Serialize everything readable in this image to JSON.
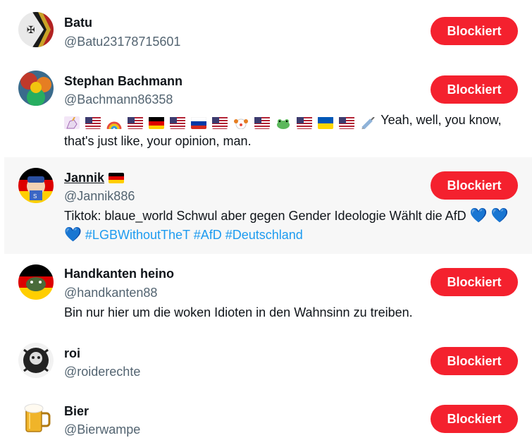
{
  "users": [
    {
      "name": "Batu",
      "handle": "@Batu23178715601",
      "button": "Blockiert"
    },
    {
      "name": "Stephan Bachmann",
      "handle": "@Bachmann86358",
      "button": "Blockiert",
      "bio": "Yeah, well, you know, that's just like, your opinion, man.",
      "bio_emojis": [
        "unicorn-emoji",
        "us-flag",
        "rainbow-emoji",
        "us-flag",
        "germany-flag",
        "us-flag",
        "russia-flag",
        "us-flag",
        "clown-emoji",
        "us-flag",
        "frog-emoji",
        "us-flag",
        "ukraine-flag",
        "us-flag",
        "syringe-emoji"
      ]
    },
    {
      "name": "Jannik",
      "handle": "@Jannik886",
      "button": "Blockiert",
      "bio_text": "Tiktok: blaue_world Schwul aber gegen Gender Ideologie Wählt die AfD",
      "bio_heart1": "💙",
      "bio_hearts2": "💙💙",
      "hashtags": [
        "#LGBWithoutTheT",
        "#AfD",
        "#Deutschland"
      ]
    },
    {
      "name": "Handkanten heino",
      "handle": "@handkanten88",
      "button": "Blockiert",
      "bio": "Bin nur hier um die woken Idioten in den Wahnsinn zu treiben."
    },
    {
      "name": "roi",
      "handle": "@roiderechte",
      "button": "Blockiert"
    },
    {
      "name": "Bier",
      "handle": "@Bierwampe",
      "button": "Blockiert"
    }
  ],
  "colors": {
    "button": "#f4212e",
    "link": "#1d9bf0",
    "handle": "#536471"
  }
}
